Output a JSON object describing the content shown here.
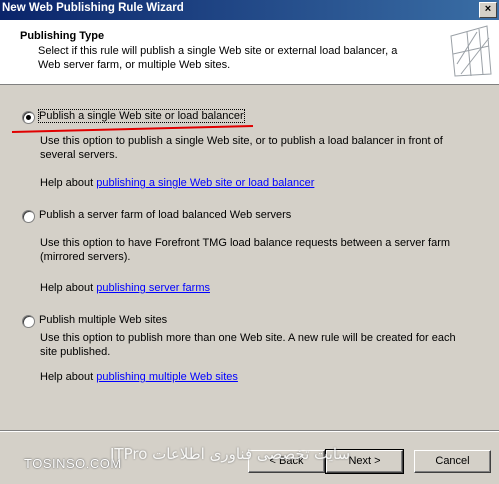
{
  "window": {
    "title": "New Web Publishing Rule Wizard",
    "close_glyph": "×"
  },
  "header": {
    "title": "Publishing Type",
    "description": "Select if this rule will publish a single Web site or external load balancer, a Web server farm, or multiple Web sites."
  },
  "options": [
    {
      "label": "Publish a single Web site or load balancer",
      "checked": true,
      "description": "Use this option to publish a single Web site, or to publish a load balancer in front of several servers.",
      "help_prefix": "Help about ",
      "help_link": "publishing a single Web site or load balancer"
    },
    {
      "label": "Publish a server farm of load balanced Web servers",
      "checked": false,
      "description": "Use this option to have Forefront TMG load balance requests between a server farm (mirrored servers).",
      "help_prefix": "Help about ",
      "help_link": "publishing server farms"
    },
    {
      "label": "Publish multiple Web sites",
      "checked": false,
      "description": "Use this option to publish more than one Web site. A new rule will be created for each site published.",
      "help_prefix": "Help about ",
      "help_link": "publishing multiple Web sites"
    }
  ],
  "buttons": {
    "back": "< Back",
    "next": "Next >",
    "cancel": "Cancel"
  },
  "watermark": {
    "left": "TOSINSO.COM",
    "right": "ITPro سایت تخصصی فناوری اطلاعات"
  },
  "colors": {
    "title_bar": "#0a246a",
    "link": "#0000ff",
    "annotation": "#e00000",
    "dialog_bg": "#d4d0c8"
  }
}
